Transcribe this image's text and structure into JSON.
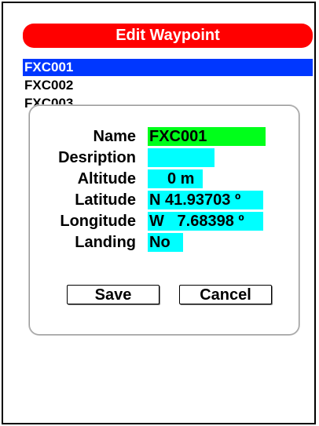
{
  "header": {
    "title": "Edit Waypoint"
  },
  "waypoint_list": {
    "items": [
      {
        "label": "FXC001",
        "selected": true
      },
      {
        "label": "FXC002",
        "selected": false
      },
      {
        "label": "FXC003",
        "selected": false
      }
    ]
  },
  "dialog": {
    "fields": {
      "name": {
        "label": "Name",
        "value": "FXC001"
      },
      "description": {
        "label": "Desription",
        "value": ""
      },
      "altitude": {
        "label": "Altitude",
        "value": "0 m"
      },
      "latitude": {
        "label": "Latitude",
        "value": "N 41.93703 º"
      },
      "longitude": {
        "label": "Longitude",
        "value": "W   7.68398 º"
      },
      "landing": {
        "label": "Landing",
        "value": "No"
      }
    },
    "buttons": {
      "save_label": "Save",
      "cancel_label": "Cancel"
    }
  },
  "colors": {
    "title_bar": "#ff0000",
    "selected_row": "#0037ff",
    "name_field": "#00ff1a",
    "value_field": "#00ffff"
  }
}
